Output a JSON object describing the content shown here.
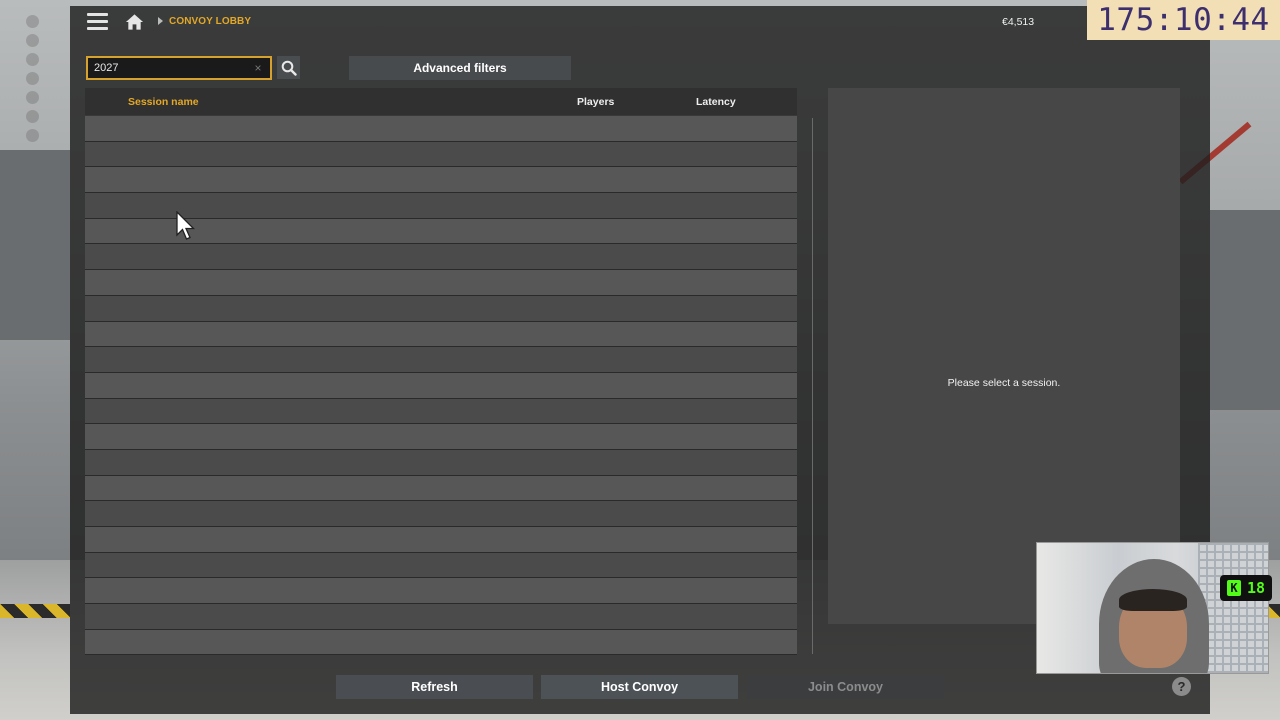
{
  "header": {
    "breadcrumb": "CONVOY LOBBY",
    "money": "€4,513"
  },
  "timer": "175:10:44",
  "search": {
    "value": "2027",
    "clear_glyph": "×"
  },
  "filters": {
    "advanced_label": "Advanced filters"
  },
  "table": {
    "columns": [
      "Session name",
      "Players",
      "Latency"
    ],
    "rows": []
  },
  "detail": {
    "placeholder": "Please select a session."
  },
  "actions": {
    "refresh": "Refresh",
    "host": "Host Convoy",
    "join": "Join Convoy",
    "help": "?"
  },
  "stream_badge": {
    "k": "K",
    "count": "18"
  },
  "colors": {
    "accent": "#e3a827",
    "panel": "#1e1e1e",
    "row_light": "#575757",
    "row_dark": "#4b4b4b"
  }
}
